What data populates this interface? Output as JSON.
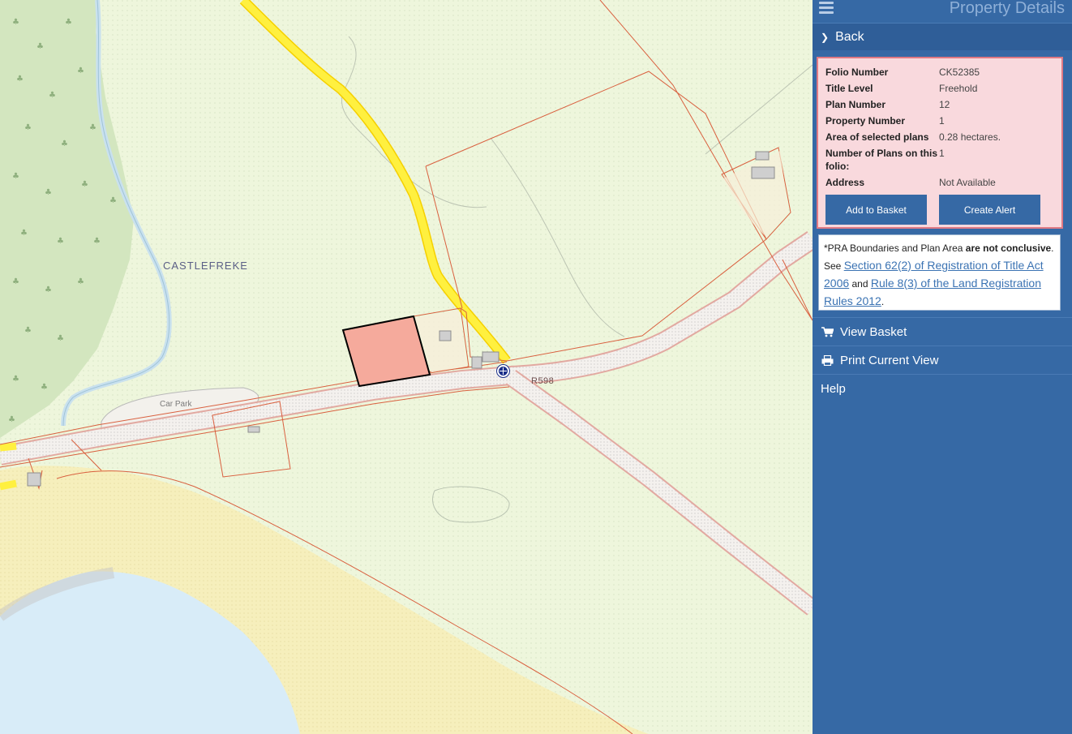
{
  "map": {
    "place_label": "CASTLEFREKE",
    "carpark_label": "Car Park",
    "road_label": "R598",
    "colors": {
      "land": "#eef6dc",
      "forest": "#d3e6bf",
      "sea": "#d8ecf8",
      "beach": "#f6efbc",
      "boundary": "#d9603f",
      "road_major": "#ffee3a",
      "selected_parcel": "#f5aa9c"
    }
  },
  "panel": {
    "title": "Property Details",
    "back_label": "Back",
    "details": [
      {
        "label": "Folio Number",
        "value": "CK52385"
      },
      {
        "label": "Title Level",
        "value": "Freehold"
      },
      {
        "label": "Plan Number",
        "value": "12"
      },
      {
        "label": "Property Number",
        "value": "1"
      },
      {
        "label": "Area of selected plans",
        "value": "0.28 hectares."
      },
      {
        "label": "Number of Plans on this folio:",
        "value": "1"
      },
      {
        "label": "Address",
        "value": "Not Available"
      }
    ],
    "add_basket_label": "Add to Basket",
    "create_alert_label": "Create Alert",
    "disclaimer": {
      "prefix": "*PRA Boundaries and Plan Area ",
      "bold": "are not conclusive",
      "see": ". See ",
      "link1": "Section 62(2) of Registration of Title Act 2006",
      "and": " and ",
      "link2": "Rule 8(3) of the Land Registration Rules 2012",
      "suffix": "."
    },
    "menu": [
      {
        "icon": "cart-icon",
        "label": "View Basket"
      },
      {
        "icon": "print-icon",
        "label": "Print Current View"
      },
      {
        "icon": "",
        "label": "Help"
      }
    ]
  }
}
